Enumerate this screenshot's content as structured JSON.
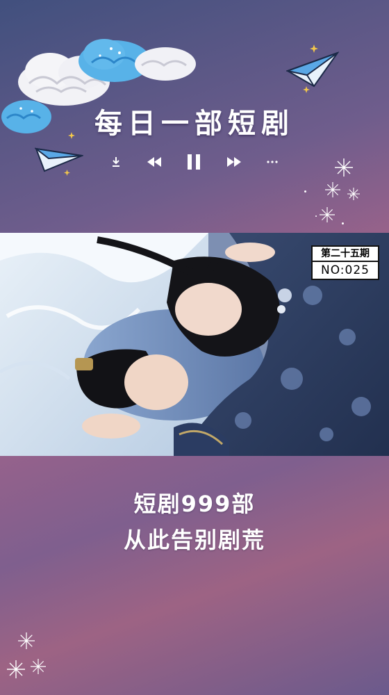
{
  "header": {
    "title": "每日一部短剧",
    "controls": [
      {
        "icon": "download-icon",
        "label": "download"
      },
      {
        "icon": "rewind-icon",
        "label": "previous"
      },
      {
        "icon": "pause-icon",
        "label": "pause"
      },
      {
        "icon": "fast-forward-icon",
        "label": "next"
      },
      {
        "icon": "more-icon",
        "label": "more"
      }
    ]
  },
  "episode": {
    "issue_label": "第二十五期",
    "number_label": "NO:025"
  },
  "caption": {
    "line1": "短剧999部",
    "line2": "从此告别剧荒"
  },
  "colors": {
    "bg_top": "#41507e",
    "bg_mid": "#a0638a",
    "cloud_blue": "#58b2e8",
    "cloud_white": "#f2f2f6",
    "plane_blue": "#5aa8e6"
  }
}
